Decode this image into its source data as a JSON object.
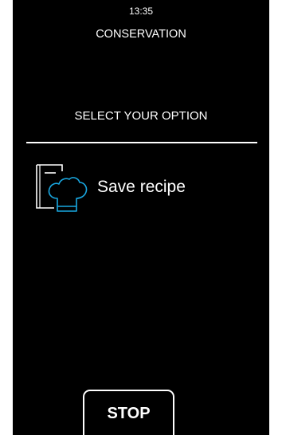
{
  "status": {
    "time": "13:35",
    "mode": "CONSERVATION"
  },
  "prompt": "SELECT YOUR OPTION",
  "options": [
    {
      "label": "Save recipe",
      "icon": "save-recipe-icon"
    }
  ],
  "stop_button": {
    "label": "STOP"
  },
  "colors": {
    "background": "#000000",
    "text": "#ffffff",
    "icon_outline": "#ffffff",
    "icon_accent": "#19a7e0"
  }
}
